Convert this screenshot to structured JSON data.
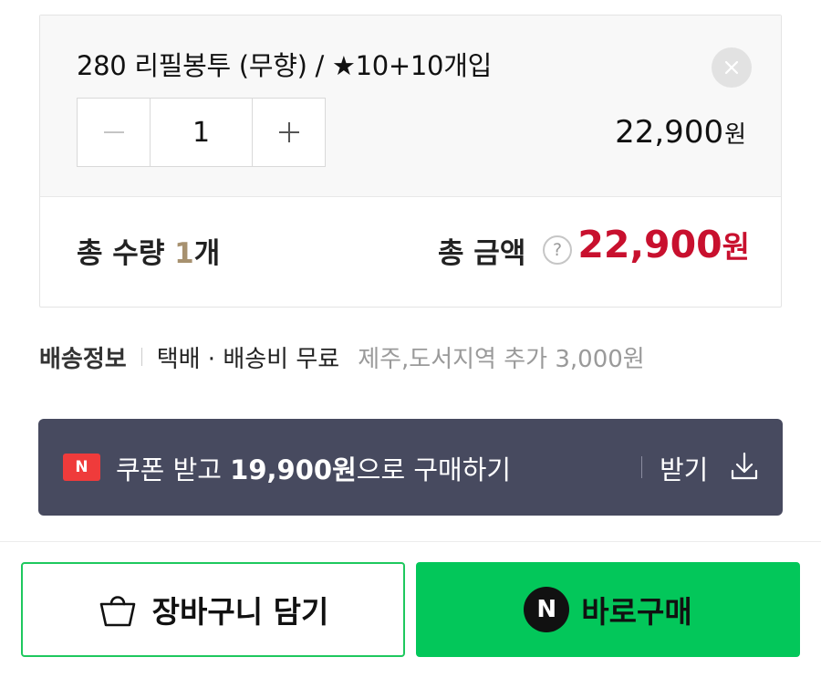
{
  "option": {
    "name": "280 리필봉투 (무향) / ★10+10개입",
    "quantity": "1",
    "price": "22,900",
    "price_unit": "원",
    "minus_symbol": "−",
    "plus_symbol": "+",
    "remove_icon": "close-icon"
  },
  "totals": {
    "qty_label": "총 수량",
    "qty_value": "1",
    "qty_unit": "개",
    "amount_label": "총 금액",
    "help_symbol": "?",
    "amount_value": "22,900",
    "amount_unit": "원"
  },
  "shipping": {
    "label": "배송정보",
    "method": "택배 · 배송비 무료",
    "extra": "제주,도서지역 추가 3,000원"
  },
  "coupon": {
    "logo_letter": "N",
    "text_prefix": "쿠폰 받고 ",
    "text_price": "19,900원",
    "text_suffix": "으로 구매하기",
    "receive_label": "받기"
  },
  "actions": {
    "cart_label": "장바구니 담기",
    "buy_logo_letter": "N",
    "buy_label": "바로구매"
  },
  "colors": {
    "total_amount": "#c8102e",
    "qty_highlight": "#a7916f",
    "coupon_bg": "#474a5f",
    "coupon_logo": "#ef3b3b",
    "buy_button": "#03c75a",
    "cart_border": "#1ec85e"
  }
}
